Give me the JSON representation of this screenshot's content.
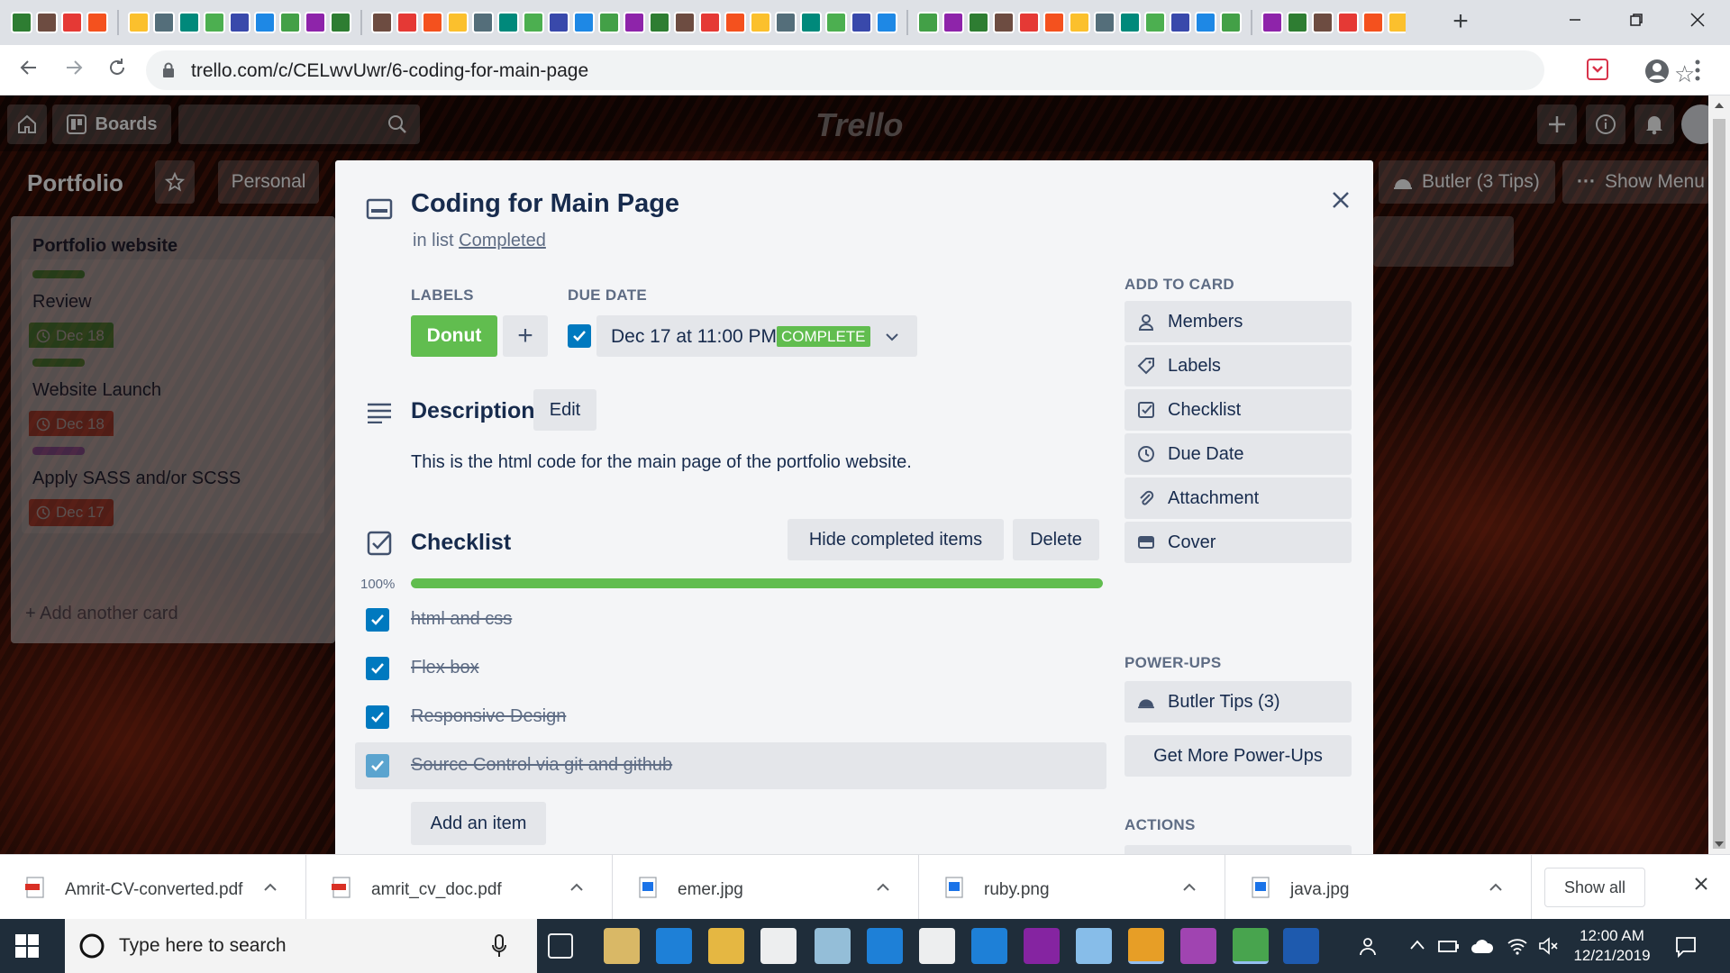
{
  "browser": {
    "new_tab_label": "+",
    "url": "trello.com/c/CELwvUwr/6-coding-for-main-page"
  },
  "trello_header": {
    "boards_label": "Boards",
    "logo_text": "Trello"
  },
  "board": {
    "title": "Portfolio",
    "visibility": "Personal",
    "butler_label": "Butler (3 Tips)",
    "show_menu_label": "Show Menu"
  },
  "list": {
    "title": "Portfolio website",
    "cards": [
      {
        "title": "Review",
        "due": "Dec 18",
        "label_color": "#61bd4f",
        "due_color": "#61bd4f"
      },
      {
        "title": "Website Launch",
        "due": "Dec 18",
        "label_color": "#61bd4f",
        "due_color": "#eb5a46"
      },
      {
        "title": "Apply SASS and/or SCSS",
        "due": "Dec 17",
        "label_color": "#c377e0",
        "due_color": "#eb5a46"
      }
    ],
    "add_card_label": "Add another card"
  },
  "modal": {
    "title": "Coding for Main Page",
    "in_list_prefix": "in list",
    "list_name": "Completed",
    "labels_heading": "LABELS",
    "label_name": "Donut",
    "label_color": "#61bd4f",
    "add_label": "+",
    "due_heading": "DUE DATE",
    "due_text": "Dec 17 at 11:00 PM",
    "due_badge": "COMPLETE",
    "description_heading": "Description",
    "edit_label": "Edit",
    "description_text": "This is the html code for the main page of the portfolio website.",
    "checklist_heading": "Checklist",
    "hide_completed_label": "Hide completed items",
    "delete_label": "Delete",
    "checklist_percent": "100%",
    "checklist_progress": 1.0,
    "checklist_items": [
      {
        "text": "html and css",
        "checked": true
      },
      {
        "text": "Flex box",
        "checked": true
      },
      {
        "text": "Responsive Design",
        "checked": true
      },
      {
        "text": "Source Control via git and github",
        "checked": true
      }
    ],
    "add_item_label": "Add an item",
    "add_to_card_heading": "ADD TO CARD",
    "add_to_card": [
      {
        "label": "Members",
        "icon": "person-icon"
      },
      {
        "label": "Labels",
        "icon": "tag-icon"
      },
      {
        "label": "Checklist",
        "icon": "checklist-icon"
      },
      {
        "label": "Due Date",
        "icon": "clock-icon"
      },
      {
        "label": "Attachment",
        "icon": "paperclip-icon"
      },
      {
        "label": "Cover",
        "icon": "cover-icon"
      }
    ],
    "power_ups_heading": "POWER-UPS",
    "butler_tips_label": "Butler Tips (3)",
    "get_more_label": "Get More Power-Ups",
    "actions_heading": "ACTIONS"
  },
  "downloads": {
    "items": [
      {
        "name": "Amrit-CV-converted.pdf",
        "type": "pdf"
      },
      {
        "name": "amrit_cv_doc.pdf",
        "type": "pdf"
      },
      {
        "name": "emer.jpg",
        "type": "image"
      },
      {
        "name": "ruby.png",
        "type": "image"
      },
      {
        "name": "java.jpg",
        "type": "image"
      }
    ],
    "show_all_label": "Show all"
  },
  "taskbar": {
    "search_placeholder": "Type here to search",
    "time": "12:00 AM",
    "date": "12/21/2019"
  },
  "colors": {
    "trello_blue": "#0079bf",
    "trello_green": "#61bd4f",
    "trello_red": "#eb5a46"
  }
}
